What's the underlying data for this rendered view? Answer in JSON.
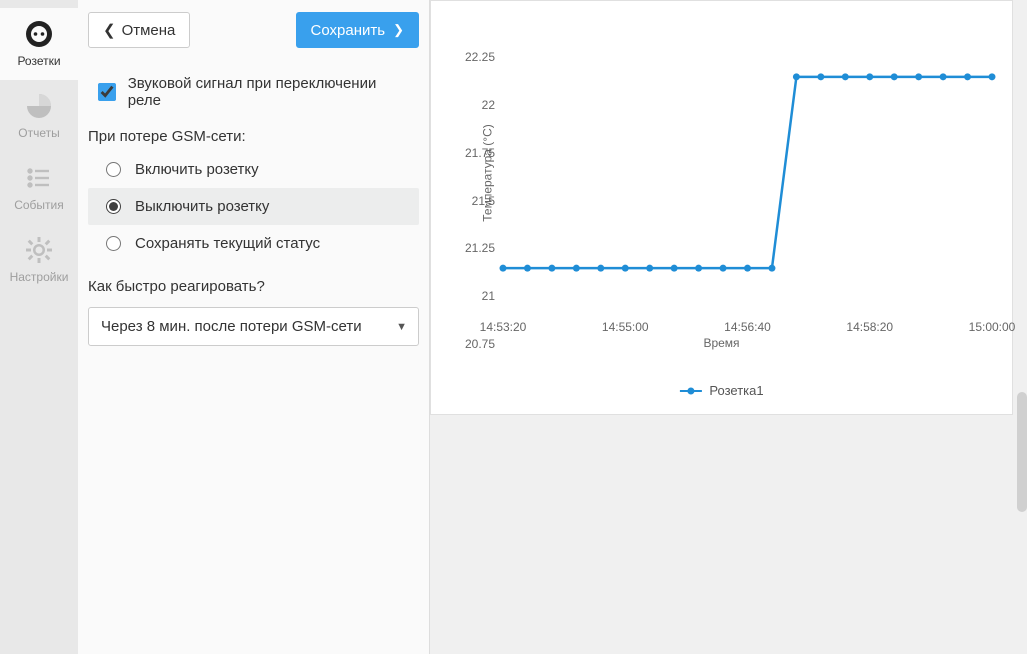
{
  "sidebar": {
    "items": [
      {
        "label": "Розетки",
        "icon": "socket"
      },
      {
        "label": "Отчеты",
        "icon": "pie"
      },
      {
        "label": "События",
        "icon": "list"
      },
      {
        "label": "Настройки",
        "icon": "gear"
      }
    ]
  },
  "toolbar": {
    "cancel_label": "Отмена",
    "save_label": "Сохранить"
  },
  "settings": {
    "sound_checkbox_label": "Звуковой сигнал при переключении реле",
    "sound_checkbox_checked": true,
    "gsm_loss_label": "При потере GSM-сети:",
    "gsm_options": [
      {
        "label": "Включить розетку",
        "value": "on",
        "selected": false
      },
      {
        "label": "Выключить розетку",
        "value": "off",
        "selected": true
      },
      {
        "label": "Сохранять текущий статус",
        "value": "keep",
        "selected": false
      }
    ],
    "reaction_label": "Как быстро реагировать?",
    "reaction_selected": "Через 8 мин. после потери GSM-сети"
  },
  "chart_data": {
    "type": "line",
    "ylabel": "Температура (°C)",
    "xlabel": "Время",
    "legend": "Розетка1",
    "ylim": [
      20.75,
      22.25
    ],
    "y_ticks": [
      "22.25",
      "22",
      "21.75",
      "21.5",
      "21.25",
      "21",
      "20.75"
    ],
    "x_ticks": [
      "14:53:20",
      "14:55:00",
      "14:56:40",
      "14:58:20",
      "15:00:00"
    ],
    "x": [
      "14:53:20",
      "14:53:40",
      "14:54:00",
      "14:54:20",
      "14:54:40",
      "14:55:00",
      "14:55:20",
      "14:55:40",
      "14:56:00",
      "14:56:20",
      "14:56:40",
      "14:57:00",
      "14:57:20",
      "14:57:40",
      "14:58:00",
      "14:58:20",
      "14:58:40",
      "14:59:00",
      "14:59:20",
      "14:59:40",
      "15:00:00"
    ],
    "series": [
      {
        "name": "Розетка1",
        "color": "#1f8dd6",
        "values": [
          21,
          21,
          21,
          21,
          21,
          21,
          21,
          21,
          21,
          21,
          21,
          21,
          22,
          22,
          22,
          22,
          22,
          22,
          22,
          22,
          22
        ]
      }
    ]
  }
}
